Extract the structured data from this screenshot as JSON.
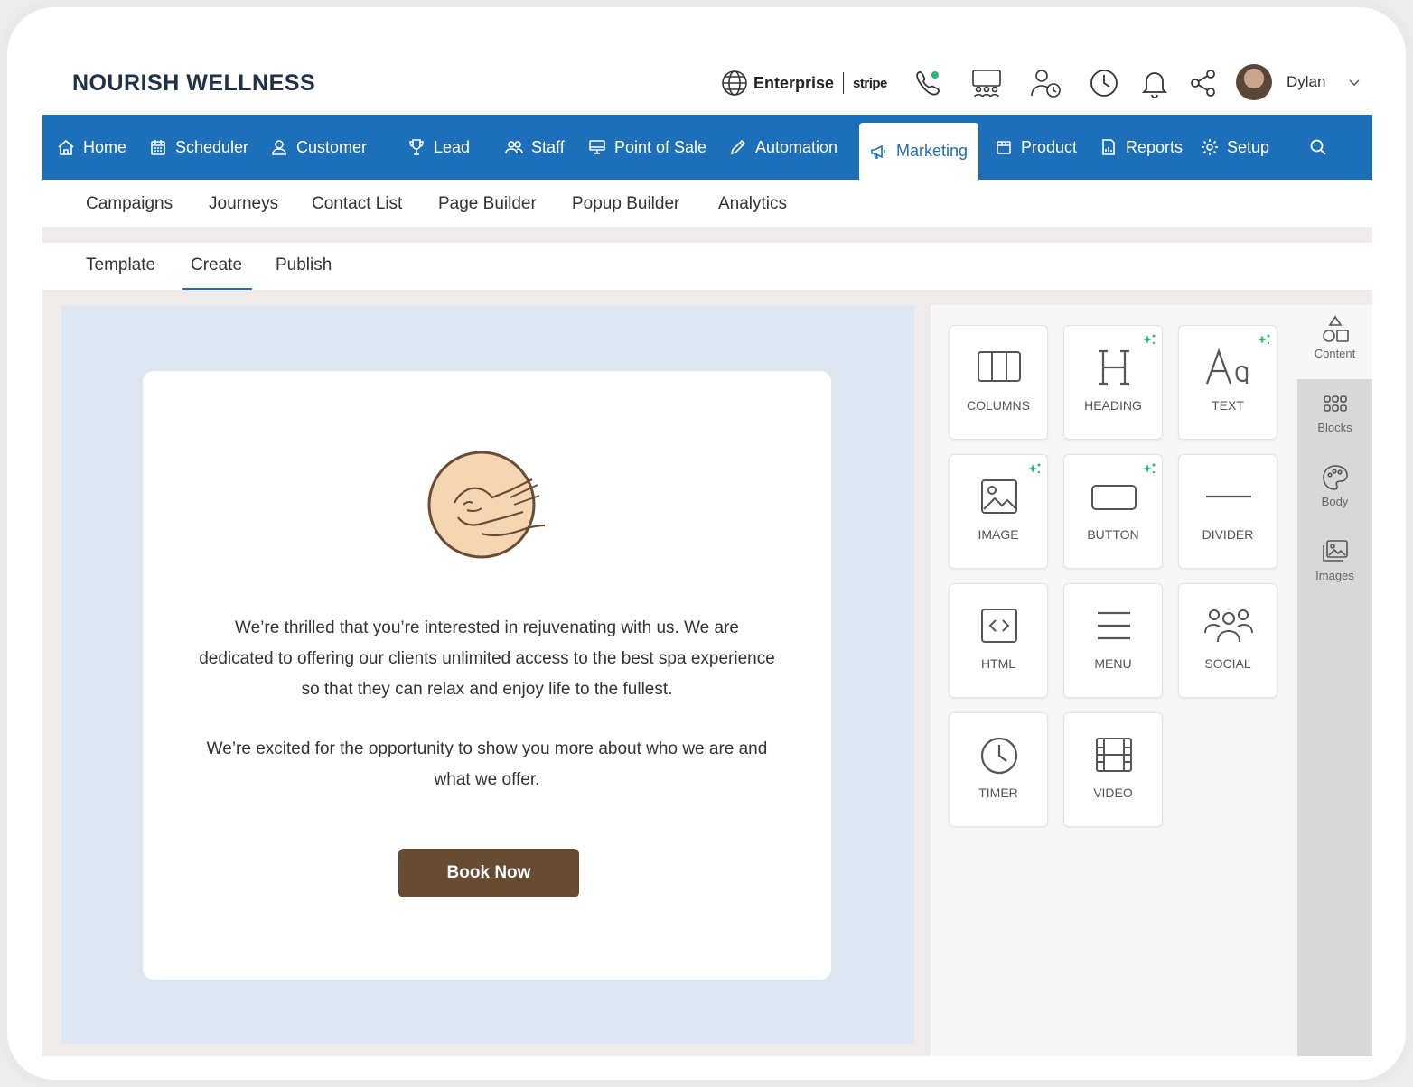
{
  "brand": "NOURISH WELLNESS",
  "header": {
    "plan": "Enterprise",
    "payment": "stripe",
    "user": "Dylan",
    "icons": [
      "globe-icon",
      "phone-icon",
      "meeting-icon",
      "user-clock-icon",
      "clock-icon",
      "bell-icon",
      "share-icon"
    ]
  },
  "nav": {
    "items": [
      {
        "label": "Home",
        "icon": "home-icon"
      },
      {
        "label": "Scheduler",
        "icon": "calendar-icon"
      },
      {
        "label": "Customer",
        "icon": "user-icon"
      },
      {
        "label": "Lead",
        "icon": "trophy-icon"
      },
      {
        "label": "Staff",
        "icon": "users-icon"
      },
      {
        "label": "Point of Sale",
        "icon": "monitor-icon"
      },
      {
        "label": "Automation",
        "icon": "pencil-icon"
      },
      {
        "label": "Marketing",
        "icon": "megaphone-icon"
      },
      {
        "label": "Product",
        "icon": "box-icon"
      },
      {
        "label": "Reports",
        "icon": "report-icon"
      },
      {
        "label": "Setup",
        "icon": "gear-icon"
      }
    ],
    "active": "Marketing"
  },
  "subnav": {
    "tabs": [
      "Campaigns",
      "Journeys",
      "Contact List",
      "Page Builder",
      "Popup Builder",
      "Analytics"
    ],
    "active": "Page Builder"
  },
  "steps": {
    "tabs": [
      "Template",
      "Create",
      "Publish"
    ],
    "active": "Create"
  },
  "email": {
    "paragraph1": "We’re thrilled that you’re interested in rejuvenating with us. We are dedicated to offering our clients unlimited access to the best spa experience so that they can relax and enjoy life to the fullest.",
    "paragraph2": "We’re excited for the opportunity to show you more about who we are and what we offer.",
    "button": "Book Now"
  },
  "tools": [
    {
      "label": "COLUMNS",
      "icon": "columns-icon",
      "ai": false
    },
    {
      "label": "HEADING",
      "icon": "heading-icon",
      "ai": true
    },
    {
      "label": "TEXT",
      "icon": "text-icon",
      "ai": true
    },
    {
      "label": "IMAGE",
      "icon": "image-icon",
      "ai": true
    },
    {
      "label": "BUTTON",
      "icon": "button-icon",
      "ai": true
    },
    {
      "label": "DIVIDER",
      "icon": "divider-icon",
      "ai": false
    },
    {
      "label": "HTML",
      "icon": "code-icon",
      "ai": false
    },
    {
      "label": "MENU",
      "icon": "menu-icon",
      "ai": false
    },
    {
      "label": "SOCIAL",
      "icon": "social-icon",
      "ai": false
    },
    {
      "label": "TIMER",
      "icon": "timer-icon",
      "ai": false
    },
    {
      "label": "VIDEO",
      "icon": "video-icon",
      "ai": false
    }
  ],
  "rail": [
    {
      "label": "Content",
      "icon": "shapes-icon"
    },
    {
      "label": "Blocks",
      "icon": "blocks-icon"
    },
    {
      "label": "Body",
      "icon": "palette-icon"
    },
    {
      "label": "Images",
      "icon": "images-icon"
    }
  ],
  "colors": {
    "primary": "#1e6fba",
    "button": "#674b33",
    "canvas": "#dde6f1",
    "ai_sparkle": "#2bb673"
  }
}
